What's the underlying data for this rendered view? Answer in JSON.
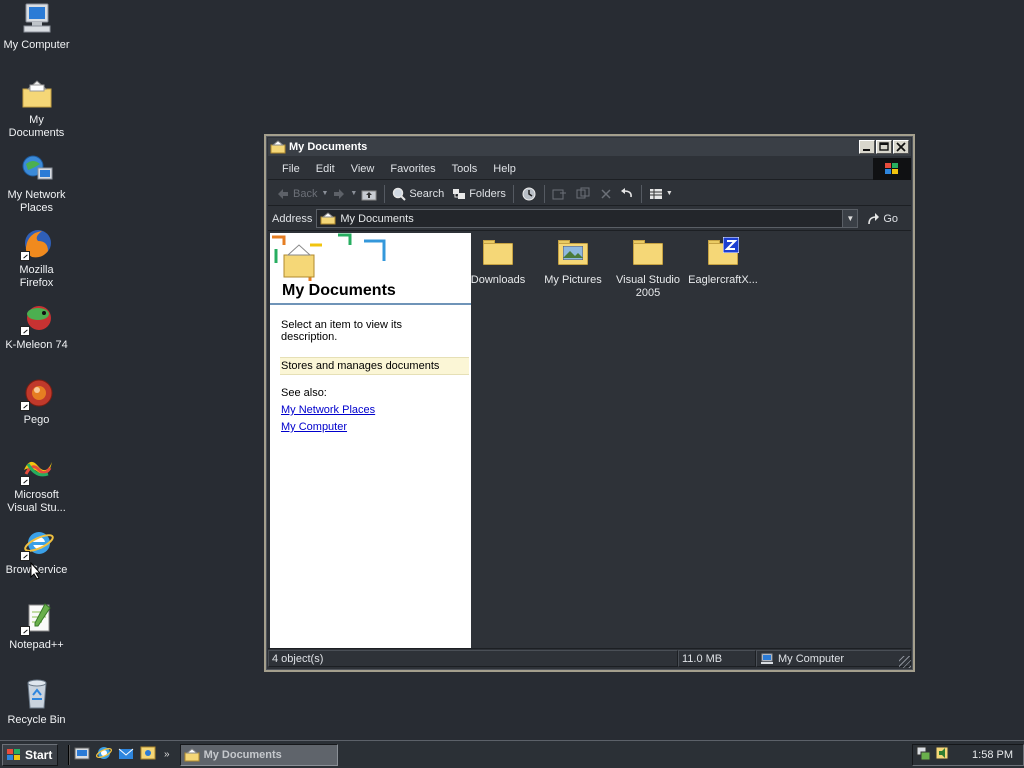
{
  "desktop": {
    "icons": [
      {
        "label": "My Computer",
        "icon": "computer-icon"
      },
      {
        "label": "My Documents",
        "icon": "documents-folder-icon"
      },
      {
        "label": "My Network Places",
        "icon": "network-places-icon"
      },
      {
        "label": "Mozilla Firefox",
        "icon": "firefox-icon"
      },
      {
        "label": "K-Meleon 74",
        "icon": "kmeleon-icon"
      },
      {
        "label": "Pego",
        "icon": "pego-icon"
      },
      {
        "label": "Microsoft Visual Stu...",
        "icon": "visual-studio-icon"
      },
      {
        "label": "BrowService",
        "icon": "internet-explorer-icon"
      },
      {
        "label": "Notepad++",
        "icon": "notepad-plus-plus-icon"
      },
      {
        "label": "Recycle Bin",
        "icon": "recycle-bin-icon"
      }
    ]
  },
  "window": {
    "title": "My Documents",
    "menu": [
      "File",
      "Edit",
      "View",
      "Favorites",
      "Tools",
      "Help"
    ],
    "toolbar": {
      "back": "Back",
      "search": "Search",
      "folders": "Folders"
    },
    "address": {
      "label": "Address",
      "value": "My Documents",
      "go": "Go"
    },
    "taskpane": {
      "title": "My Documents",
      "description": "Select an item to view its description.",
      "info": "Stores and manages documents",
      "see_also": "See also:",
      "links": [
        "My Network Places",
        "My Computer"
      ]
    },
    "files": [
      {
        "name": "Downloads",
        "icon": "folder-icon"
      },
      {
        "name": "My Pictures",
        "icon": "pictures-folder-icon"
      },
      {
        "name": "Visual Studio 2005",
        "icon": "folder-icon"
      },
      {
        "name": "EaglercraftX...",
        "icon": "zip-folder-icon"
      }
    ],
    "status": {
      "objects": "4 object(s)",
      "size": "11.0 MB",
      "location": "My Computer"
    }
  },
  "taskbar": {
    "start": "Start",
    "quick_launch": [
      "show-desktop-icon",
      "internet-explorer-icon",
      "outlook-express-icon",
      "media-icon"
    ],
    "task": "My Documents",
    "clock": "1:58 PM"
  },
  "colors": {
    "desktop": "#282c33",
    "window_frame": "#a49f8d",
    "folder": "#f5d777",
    "link": "#0000cc"
  }
}
